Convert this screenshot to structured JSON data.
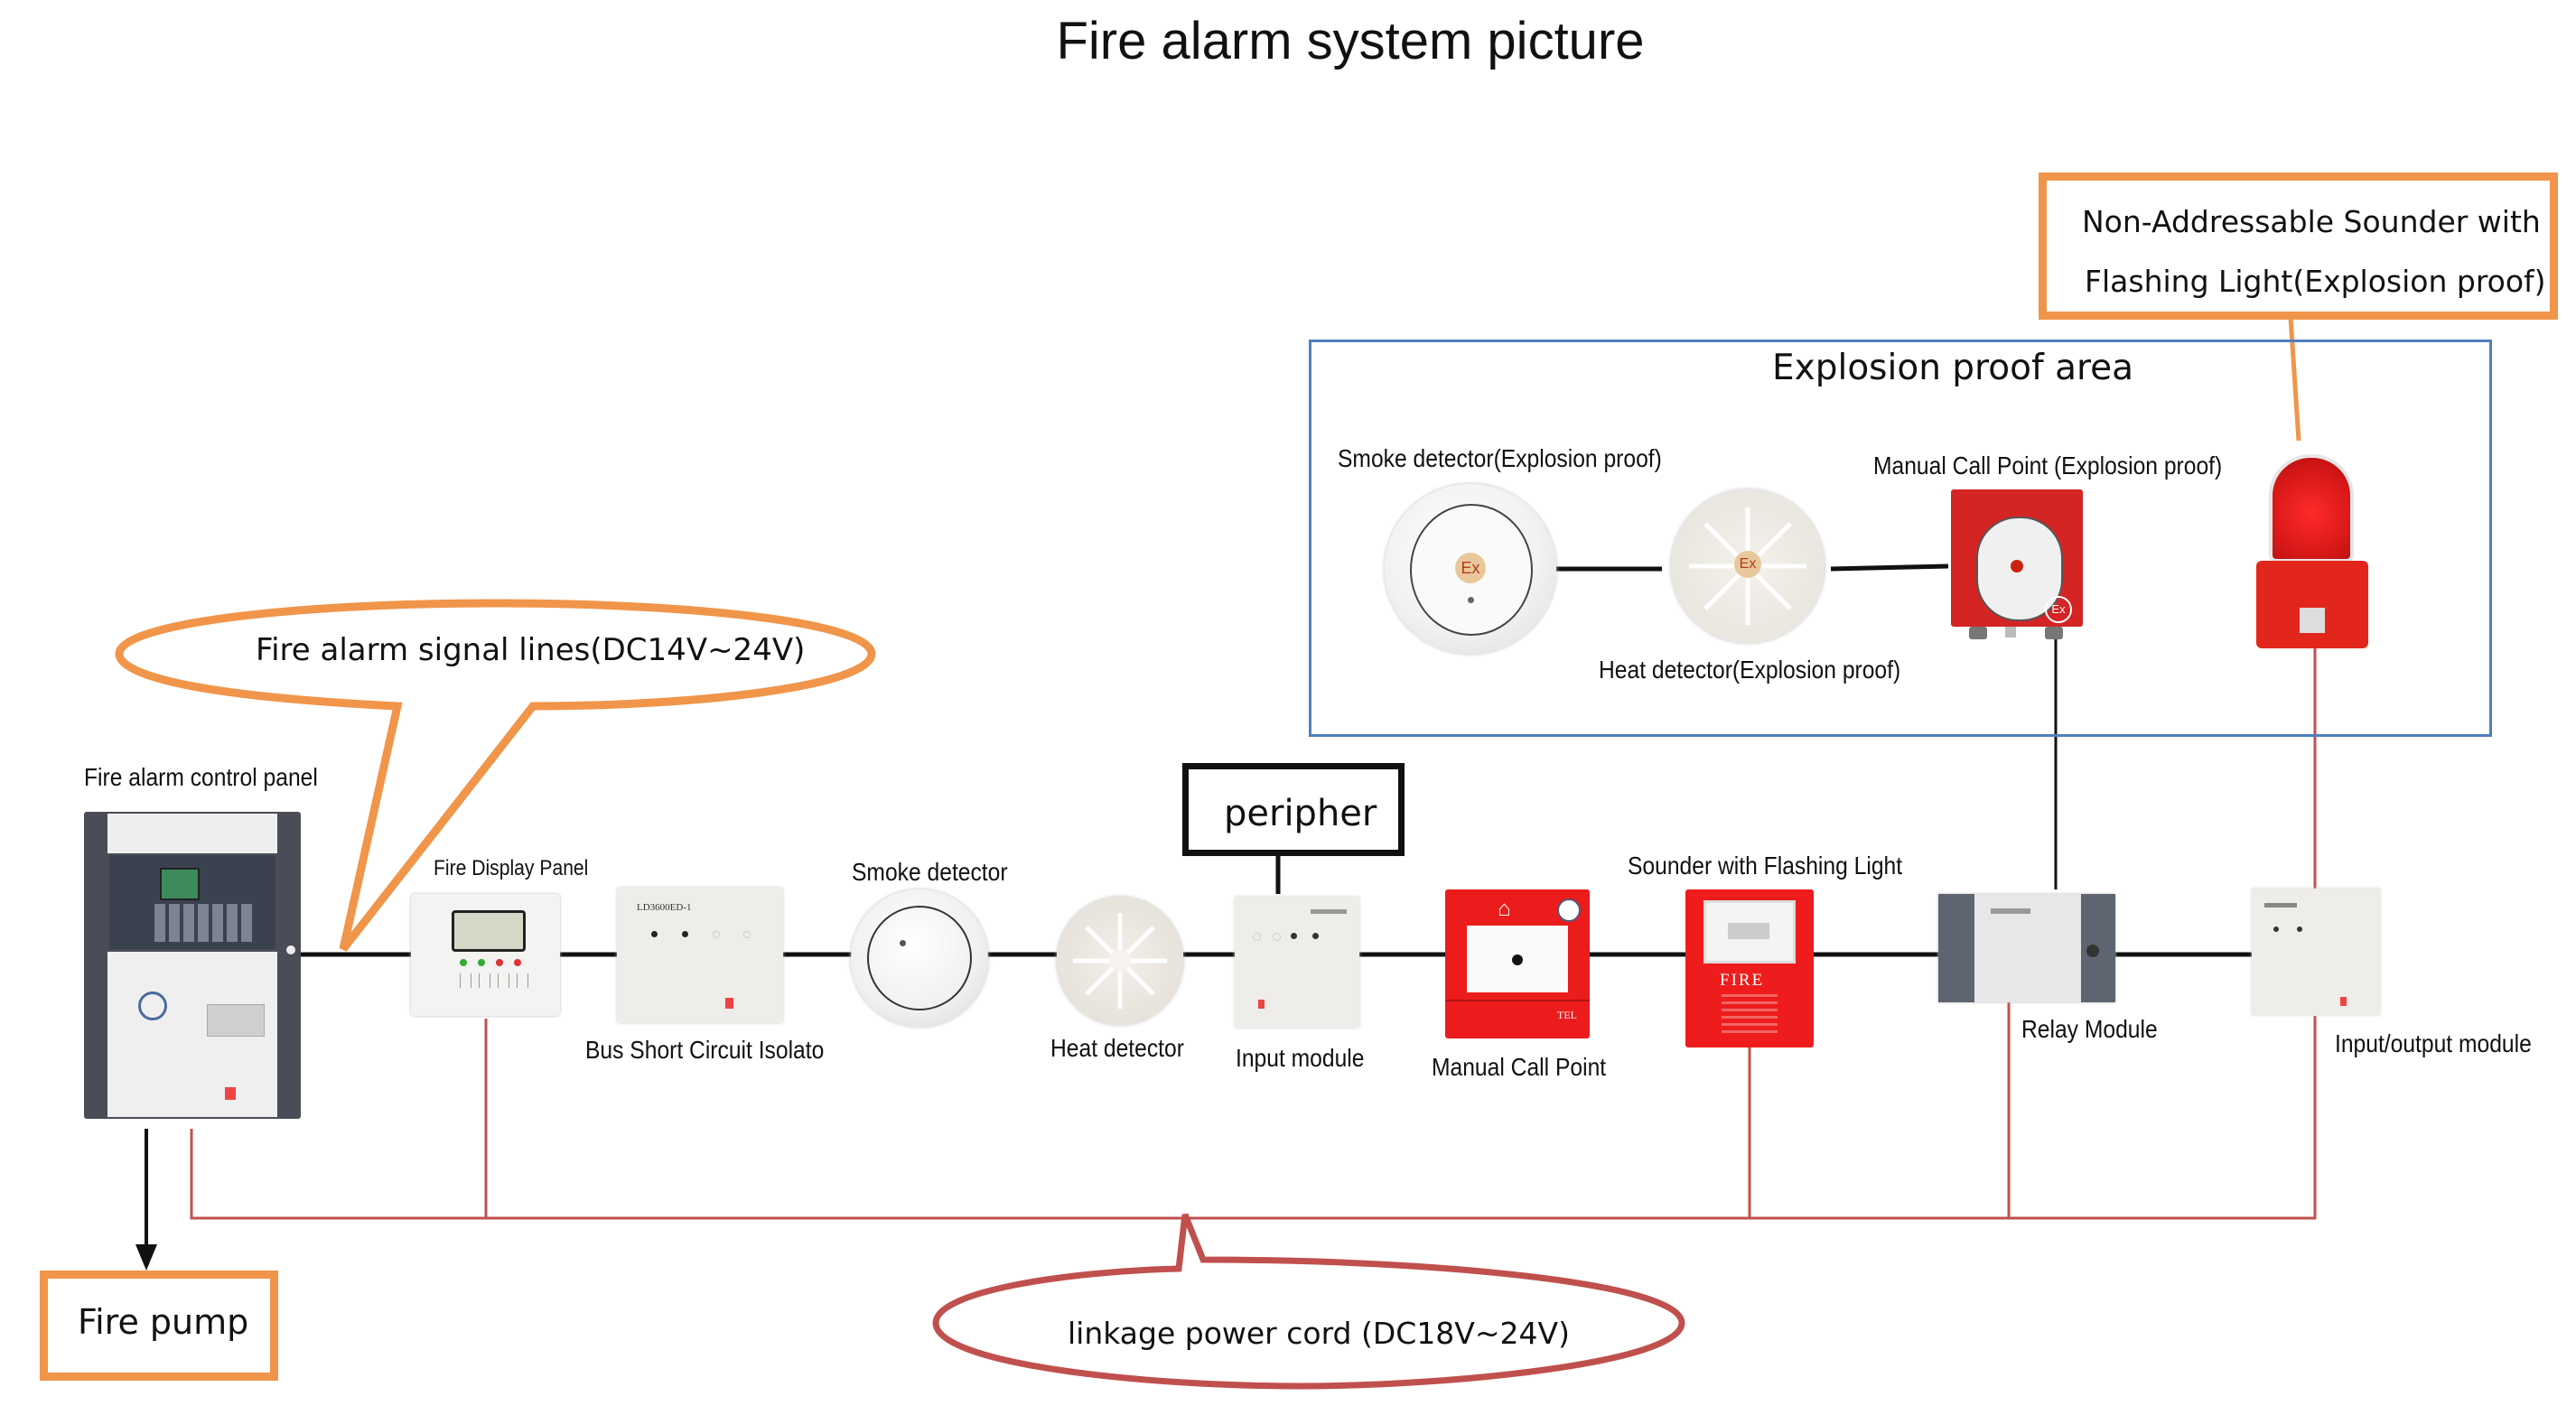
{
  "title": "Fire alarm system picture",
  "callouts": {
    "signal_lines": "Fire alarm signal lines(DC14V~24V)",
    "power_cord": "linkage power cord (DC18V~24V)",
    "non_addressable": [
      "Non-Addressable Sounder with",
      "Flashing Light(Explosion proof)"
    ],
    "fire_pump": "Fire pump",
    "peripher": "peripher"
  },
  "explosion_area": {
    "title": "Explosion proof area",
    "devices": [
      {
        "label": "Smoke detector(Explosion proof)",
        "badge": "Ex"
      },
      {
        "label": "Heat detector(Explosion proof)",
        "badge": "Ex"
      },
      {
        "label": "Manual Call Point (Explosion proof)",
        "badge": "Ex"
      }
    ]
  },
  "main_bus": {
    "devices": [
      {
        "label": "Fire alarm control panel"
      },
      {
        "label": "Fire Display Panel"
      },
      {
        "label": "Bus Short Circuit Isolato",
        "model": "LD3600ED-1"
      },
      {
        "label": "Smoke detector"
      },
      {
        "label": "Heat detector"
      },
      {
        "label": "Input module"
      },
      {
        "label": "Manual Call Point",
        "tel": "TEL"
      },
      {
        "label": "Sounder with Flashing Light",
        "text": "FIRE"
      },
      {
        "label": "Relay Module"
      },
      {
        "label": "Input/output module"
      }
    ]
  },
  "colors": {
    "signal_line": "#111111",
    "power_line": "#c0504d",
    "orange_accent": "#f0954a",
    "area_border": "#4f7fbd",
    "device_red": "#e02020"
  }
}
